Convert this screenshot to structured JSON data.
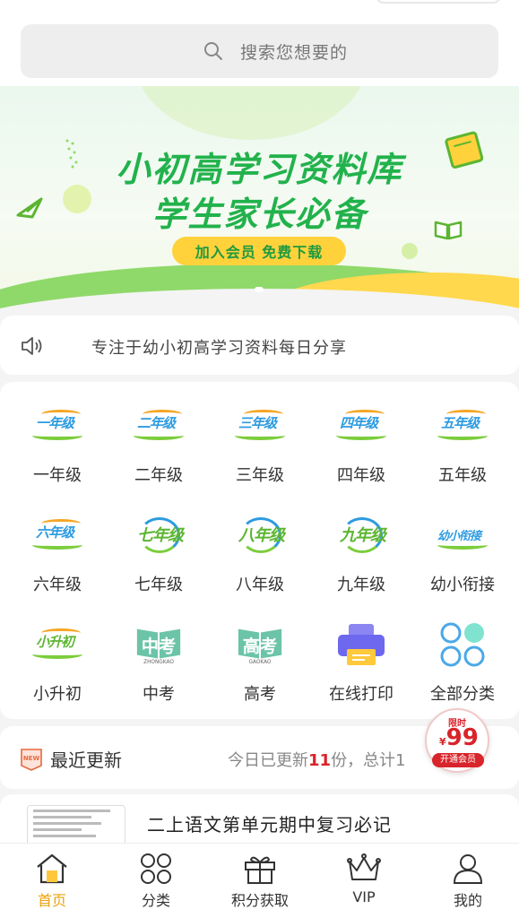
{
  "search": {
    "placeholder": "搜索您想要的"
  },
  "banner": {
    "title_line1": "小初高学习资料库",
    "title_line2": "学生家长必备",
    "cta": "加入会员 免费下载"
  },
  "notice": {
    "text": "专注于幼小初高学习资料每日分享"
  },
  "categories": [
    {
      "label": "一年级",
      "badge": "一年级"
    },
    {
      "label": "二年级",
      "badge": "二年级"
    },
    {
      "label": "三年级",
      "badge": "三年级"
    },
    {
      "label": "四年级",
      "badge": "四年级"
    },
    {
      "label": "五年级",
      "badge": "五年级"
    },
    {
      "label": "六年级",
      "badge": "六年级"
    },
    {
      "label": "七年级",
      "badge": "七年级"
    },
    {
      "label": "八年级",
      "badge": "八年级"
    },
    {
      "label": "九年级",
      "badge": "九年级"
    },
    {
      "label": "幼小衔接",
      "badge": "幼小衔接"
    },
    {
      "label": "小升初",
      "badge": "小升初"
    },
    {
      "label": "中考",
      "badge": "中考",
      "sub": "ZHONGKAO"
    },
    {
      "label": "高考",
      "badge": "高考",
      "sub": "GAOKAO"
    },
    {
      "label": "在线打印",
      "icon": "printer-icon"
    },
    {
      "label": "全部分类",
      "icon": "all-categories-icon"
    }
  ],
  "recent": {
    "title": "最近更新",
    "badge": "NEW",
    "stat_prefix": "今日已更新",
    "today_count": "11",
    "stat_mid": "份，总计1"
  },
  "vip_float": {
    "limit": "限时",
    "currency": "¥",
    "price": "99",
    "join": "开通会员"
  },
  "document": {
    "title": "二上语文第单元期中复习必记"
  },
  "tabbar": [
    {
      "label": "首页",
      "icon": "home-icon",
      "active": true
    },
    {
      "label": "分类",
      "icon": "category-icon"
    },
    {
      "label": "积分获取",
      "icon": "gift-icon"
    },
    {
      "label": "VIP",
      "icon": "crown-icon"
    },
    {
      "label": "我的",
      "icon": "user-icon"
    }
  ],
  "colors": {
    "accent": "#e8a20c",
    "brand_green": "#22b24c",
    "price_red": "#d8242b",
    "banner_button": "#ffd23c"
  }
}
